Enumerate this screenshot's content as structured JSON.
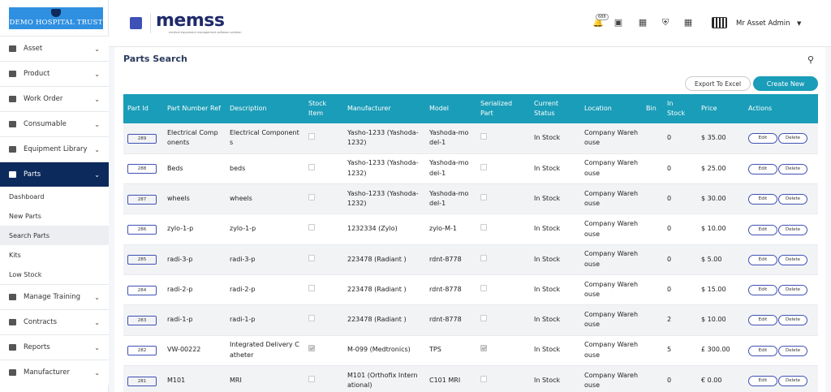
{
  "logo": {
    "text": "DEMO HOSPITAL TRUST"
  },
  "brand": {
    "name": "memss",
    "tagline": "medical equipment management software solution"
  },
  "sidebar": {
    "items": [
      {
        "label": "Asset",
        "icon": "asset-icon"
      },
      {
        "label": "Product",
        "icon": "product-icon"
      },
      {
        "label": "Work Order",
        "icon": "work-order-icon"
      },
      {
        "label": "Consumable",
        "icon": "grid-icon"
      },
      {
        "label": "Equipment Library",
        "icon": "library-icon"
      },
      {
        "label": "Parts",
        "icon": "parts-icon",
        "active": true
      }
    ],
    "sub_items": [
      {
        "label": "Dashboard"
      },
      {
        "label": "New Parts"
      },
      {
        "label": "Search Parts",
        "active": true
      },
      {
        "label": "Kits"
      },
      {
        "label": "Low Stock"
      }
    ],
    "items_after": [
      {
        "label": "Manage Training",
        "icon": "training-icon"
      },
      {
        "label": "Contracts",
        "icon": "handshake-icon"
      },
      {
        "label": "Reports",
        "icon": "reports-icon"
      },
      {
        "label": "Manufacturer",
        "icon": "manufacturer-icon"
      }
    ]
  },
  "topbar": {
    "notification_count": "688",
    "user_name": "Mr Asset Admin"
  },
  "page": {
    "title": "Parts Search",
    "export_label": "Export To Excel",
    "create_label": "Create New"
  },
  "table": {
    "headers": [
      "Part Id",
      "Part Number Ref",
      "Description",
      "Stock Item",
      "Manufacturer",
      "Model",
      "Serialized Part",
      "Current Status",
      "Location",
      "Bin",
      "In Stock",
      "Price",
      "Actions"
    ],
    "edit_label": "Edit",
    "delete_label": "Delete",
    "rows": [
      {
        "id": "289",
        "ref": "Electrical Components",
        "desc": "Electrical Components",
        "stock": false,
        "manufacturer": "Yasho-1233 (Yashoda-1232)",
        "model": "Yashoda-model-1",
        "serialized": false,
        "status": "In Stock",
        "location": "Company Warehouse",
        "bin": "",
        "in_stock": "0",
        "price": "$ 35.00"
      },
      {
        "id": "288",
        "ref": "Beds",
        "desc": "beds",
        "stock": false,
        "manufacturer": "Yasho-1233 (Yashoda-1232)",
        "model": "Yashoda-model-1",
        "serialized": false,
        "status": "In Stock",
        "location": "Company Warehouse",
        "bin": "",
        "in_stock": "0",
        "price": "$ 25.00"
      },
      {
        "id": "287",
        "ref": "wheels",
        "desc": "wheels",
        "stock": false,
        "manufacturer": "Yasho-1233 (Yashoda-1232)",
        "model": "Yashoda-model-1",
        "serialized": false,
        "status": "In Stock",
        "location": "Company Warehouse",
        "bin": "",
        "in_stock": "0",
        "price": "$ 30.00"
      },
      {
        "id": "286",
        "ref": "zylo-1-p",
        "desc": "zylo-1-p",
        "stock": false,
        "manufacturer": "1232334 (Zylo)",
        "model": "zylo-M-1",
        "serialized": false,
        "status": "In Stock",
        "location": "Company Warehouse",
        "bin": "",
        "in_stock": "0",
        "price": "$ 10.00"
      },
      {
        "id": "285",
        "ref": "radi-3-p",
        "desc": "radi-3-p",
        "stock": false,
        "manufacturer": "223478 (Radiant )",
        "model": "rdnt-8778",
        "serialized": false,
        "status": "In Stock",
        "location": "Company Warehouse",
        "bin": "",
        "in_stock": "0",
        "price": "$ 5.00"
      },
      {
        "id": "284",
        "ref": "radi-2-p",
        "desc": "radi-2-p",
        "stock": false,
        "manufacturer": "223478 (Radiant )",
        "model": "rdnt-8778",
        "serialized": false,
        "status": "In Stock",
        "location": "Company Warehouse",
        "bin": "",
        "in_stock": "0",
        "price": "$ 15.00"
      },
      {
        "id": "283",
        "ref": "radi-1-p",
        "desc": "radi-1-p",
        "stock": false,
        "manufacturer": "223478 (Radiant )",
        "model": "rdnt-8778",
        "serialized": false,
        "status": "In Stock",
        "location": "Company Warehouse",
        "bin": "",
        "in_stock": "2",
        "price": "$ 10.00"
      },
      {
        "id": "282",
        "ref": "VW-00222",
        "desc": "Integrated Delivery Catheter",
        "stock": true,
        "manufacturer": "M-099 (Medtronics)",
        "model": "TPS",
        "serialized": true,
        "status": "In Stock",
        "location": "Company Warehouse",
        "bin": "",
        "in_stock": "5",
        "price": "£ 300.00"
      },
      {
        "id": "281",
        "ref": "M101",
        "desc": "MRI",
        "stock": false,
        "manufacturer": "M101 (Orthofix International)",
        "model": "C101 MRI",
        "serialized": false,
        "status": "In Stock",
        "location": "Company Warehouse",
        "bin": "",
        "in_stock": "0",
        "price": "€ 0.00"
      }
    ]
  }
}
